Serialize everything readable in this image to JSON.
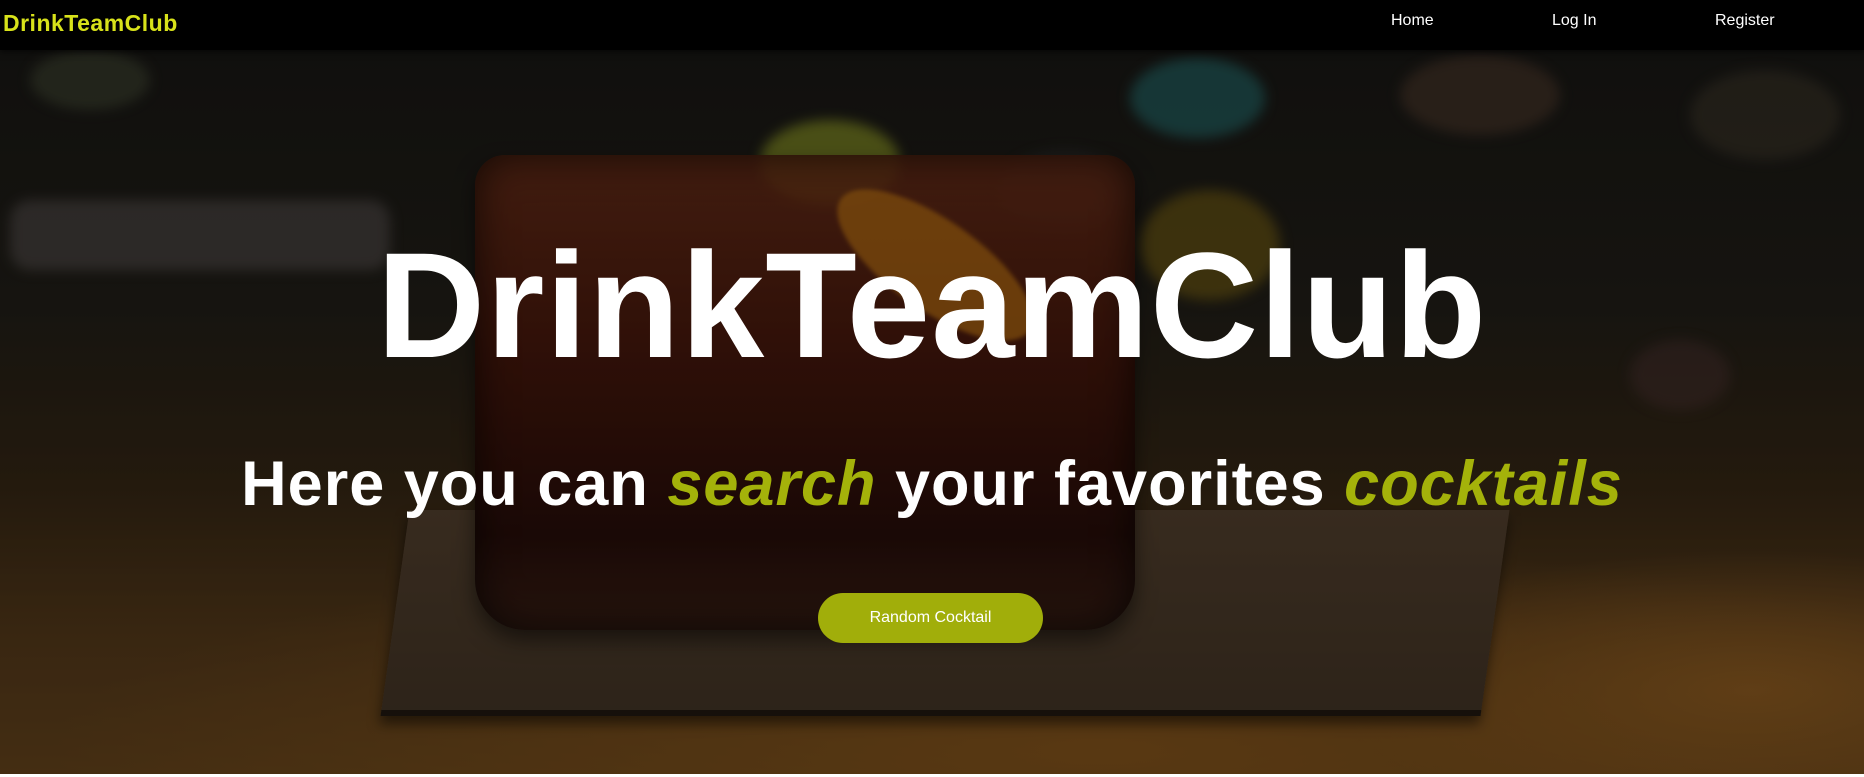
{
  "navbar": {
    "brand": "DrinkTeamClub",
    "links": {
      "home": "Home",
      "login": "Log In",
      "register": "Register"
    }
  },
  "hero": {
    "title": "DrinkTeamClub",
    "subtitle": {
      "part1": "Here you can ",
      "highlight1": "search",
      "part2": " your favorites ",
      "highlight2": "cocktails"
    },
    "button_label": "Random Cocktail"
  },
  "colors": {
    "brand": "#d8e21a",
    "accent": "#a4b20a",
    "navbar_bg": "#000000",
    "text": "#ffffff"
  }
}
